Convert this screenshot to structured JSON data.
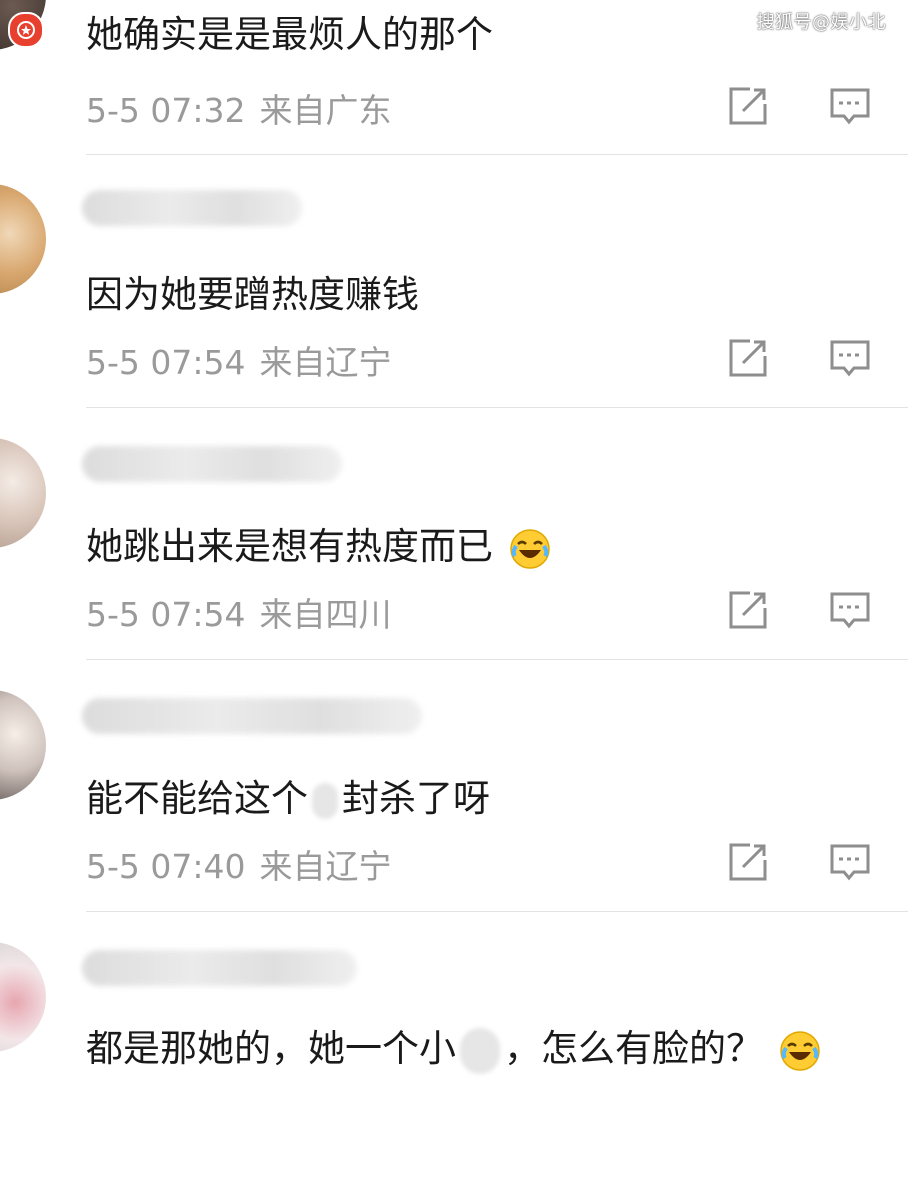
{
  "watermark": "搜狐号@娱小北",
  "comments": [
    {
      "text": "她确实是是最烦人的那个",
      "date": "5-5 07:32",
      "region": "来自广东"
    },
    {
      "text": "因为她要蹭热度赚钱",
      "date": "5-5 07:54",
      "region": "来自辽宁"
    },
    {
      "text": "她跳出来是想有热度而已",
      "date": "5-5 07:54",
      "region": "来自四川",
      "emoji": "laughing-crying-emoji"
    },
    {
      "text_before": "能不能给这个",
      "text_after": "封杀了呀",
      "date": "5-5 07:40",
      "region": "来自辽宁"
    },
    {
      "text_before": "都是那她的，她一个小",
      "text_after": "，怎么有脸的？",
      "emoji": "laughing-crying-emoji"
    }
  ],
  "icons": {
    "forward": "share-square-icon",
    "reply": "comment-bubble-icon"
  },
  "colors": {
    "meta": "#9a9a9a",
    "divider": "#e3e3e3",
    "badge": "#e8402f"
  }
}
